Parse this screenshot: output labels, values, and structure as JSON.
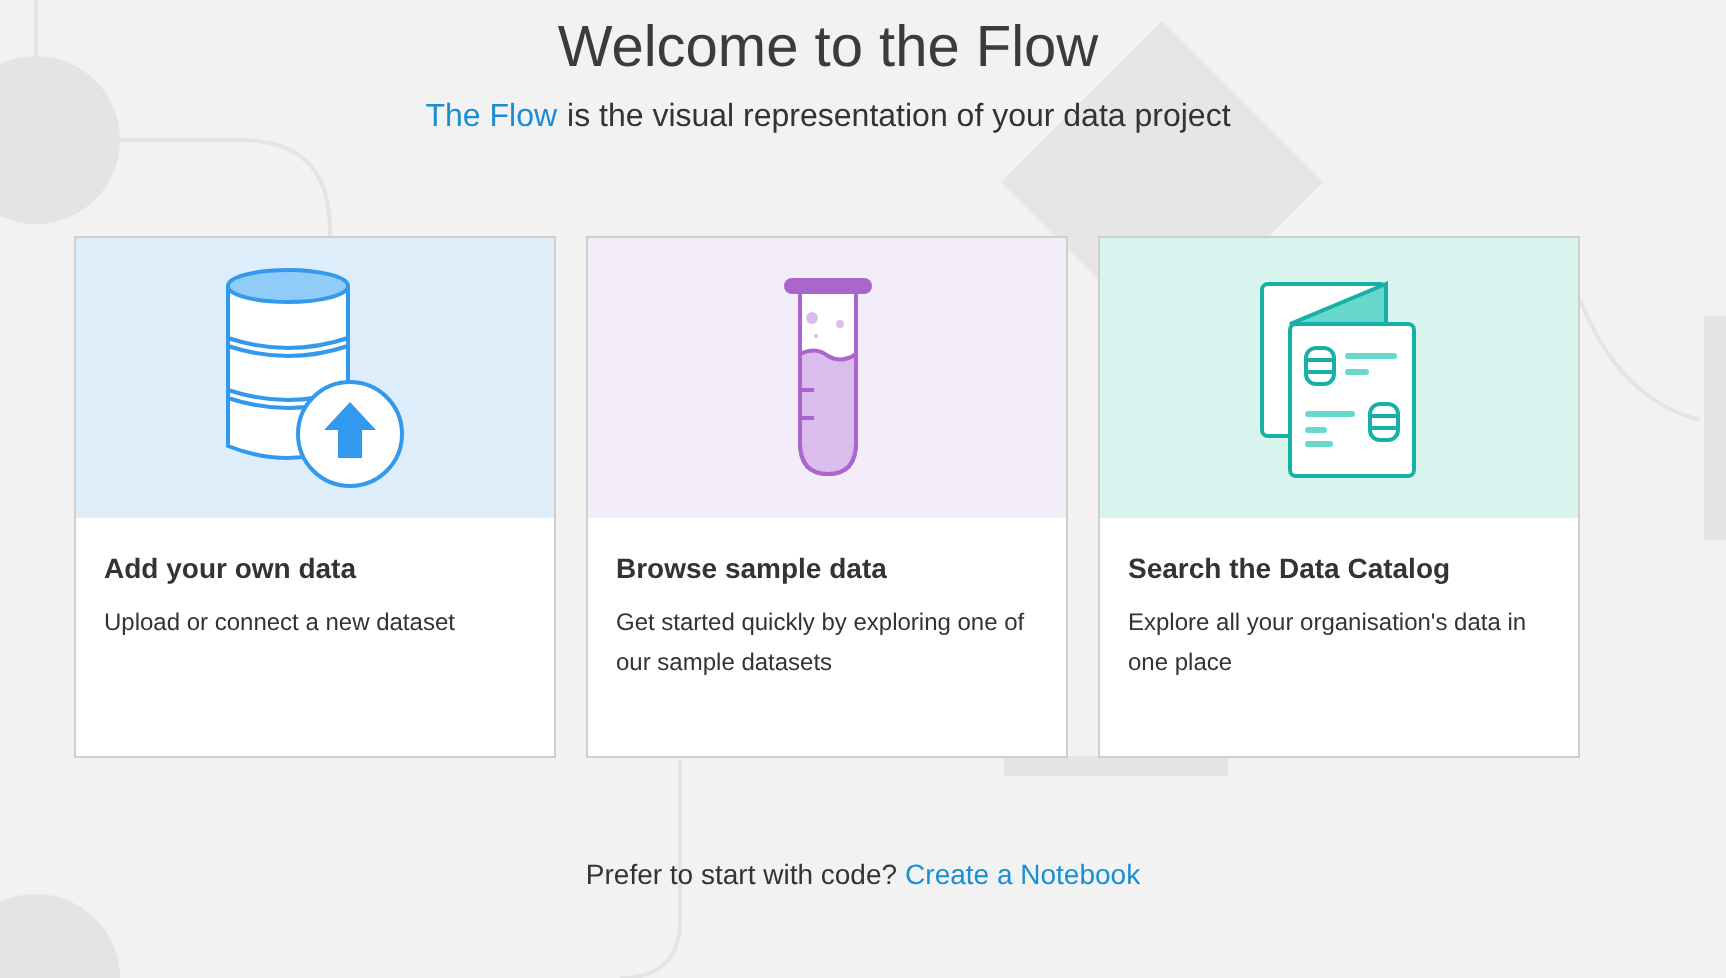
{
  "title": "Welcome to the Flow",
  "subtitle": {
    "link": "The Flow",
    "text": "is the visual representation of your data project"
  },
  "cards": [
    {
      "kind": "upload",
      "title": "Add your own data",
      "description": "Upload or connect a new dataset"
    },
    {
      "kind": "sample",
      "title": "Browse sample data",
      "description": "Get started quickly by exploring one of our sample datasets"
    },
    {
      "kind": "catalog",
      "title": "Search the Data Catalog",
      "description": "Explore all your organisation's data in one place"
    }
  ],
  "footer": {
    "text": "Prefer to start with code?",
    "link": "Create a Notebook"
  }
}
